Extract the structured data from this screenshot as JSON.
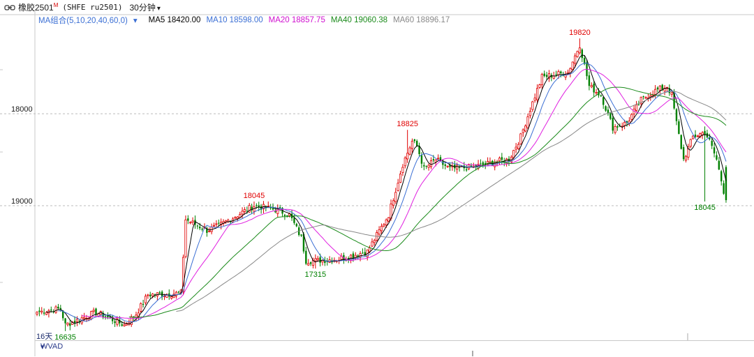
{
  "header": {
    "symbol": "橡胶2501",
    "symbol_mark": "M",
    "code": "(SHFE ru2501)",
    "period": "30分钟",
    "period_caret": "▾",
    "icon": "link-icon"
  },
  "legend": {
    "ma_group": "MA组合(5,10,20,40,60,0)",
    "ma_group_caret": "▾",
    "ma5": "MA5 18420.00",
    "ma10": "MA10 18598.00",
    "ma20": "MA20 18857.75",
    "ma40": "MA40 19060.38",
    "ma60": "MA60 18896.17",
    "colors": {
      "ma5": "#000000",
      "ma10": "#3b6fd4",
      "ma20": "#e020e0",
      "ma40": "#1a8a1a",
      "ma60": "#888888"
    }
  },
  "price_axis": {
    "labels": [
      "19000",
      "18000"
    ]
  },
  "bottom": {
    "indicator": "WVAD",
    "indicator_caret": "▾",
    "days_label": "16天"
  },
  "colors": {
    "up": "#e00000",
    "down": "#008000",
    "grid": "#c8c8c8",
    "axis": "#c8c8c8",
    "axis_text": "#1a1a1a",
    "annot_high": "#e00000",
    "annot_low": "#008000"
  },
  "chart_data": {
    "type": "candlestick",
    "y_ticks": [
      18000,
      19000
    ],
    "ylim": [
      16550,
      19950
    ],
    "annotations": [
      {
        "text": "16635",
        "value": 16635,
        "bar": 12,
        "kind": "low"
      },
      {
        "text": "18045",
        "value": 18045,
        "bar": 92,
        "kind": "high"
      },
      {
        "text": "17315",
        "value": 17315,
        "bar": 118,
        "kind": "low"
      },
      {
        "text": "18825",
        "value": 18825,
        "bar": 157,
        "kind": "high"
      },
      {
        "text": "19820",
        "value": 19820,
        "bar": 230,
        "kind": "high"
      },
      {
        "text": "18045",
        "value": 18045,
        "bar": 283,
        "kind": "low"
      }
    ],
    "anchors_close": [
      [
        0,
        16840
      ],
      [
        10,
        16880
      ],
      [
        12,
        16700
      ],
      [
        25,
        16840
      ],
      [
        37,
        16700
      ],
      [
        42,
        16820
      ],
      [
        47,
        17030
      ],
      [
        57,
        17040
      ],
      [
        61,
        17050
      ],
      [
        63,
        17850
      ],
      [
        72,
        17730
      ],
      [
        77,
        17780
      ],
      [
        92,
        18000
      ],
      [
        102,
        17950
      ],
      [
        107,
        17900
      ],
      [
        112,
        17650
      ],
      [
        114,
        17400
      ],
      [
        118,
        17400
      ],
      [
        128,
        17420
      ],
      [
        140,
        17500
      ],
      [
        149,
        17900
      ],
      [
        155,
        18450
      ],
      [
        159,
        18700
      ],
      [
        161,
        18650
      ],
      [
        164,
        18400
      ],
      [
        169,
        18500
      ],
      [
        175,
        18400
      ],
      [
        185,
        18420
      ],
      [
        195,
        18480
      ],
      [
        200,
        18500
      ],
      [
        205,
        18750
      ],
      [
        209,
        19050
      ],
      [
        214,
        19400
      ],
      [
        225,
        19450
      ],
      [
        230,
        19750
      ],
      [
        234,
        19300
      ],
      [
        239,
        19200
      ],
      [
        244,
        18850
      ],
      [
        250,
        18900
      ],
      [
        256,
        19150
      ],
      [
        262,
        19250
      ],
      [
        267,
        19300
      ],
      [
        269,
        19200
      ],
      [
        271,
        18900
      ],
      [
        274,
        18500
      ],
      [
        278,
        18750
      ],
      [
        283,
        18800
      ],
      [
        285,
        18700
      ],
      [
        288,
        18500
      ],
      [
        292,
        18045
      ]
    ],
    "series": [
      {
        "name": "MA5",
        "period": 5,
        "color": "#000000"
      },
      {
        "name": "MA10",
        "period": 10,
        "color": "#3b6fd4"
      },
      {
        "name": "MA20",
        "period": 20,
        "color": "#e020e0"
      },
      {
        "name": "MA40",
        "period": 40,
        "color": "#1a8a1a"
      },
      {
        "name": "MA60",
        "period": 60,
        "color": "#888888"
      }
    ],
    "grid": true
  }
}
